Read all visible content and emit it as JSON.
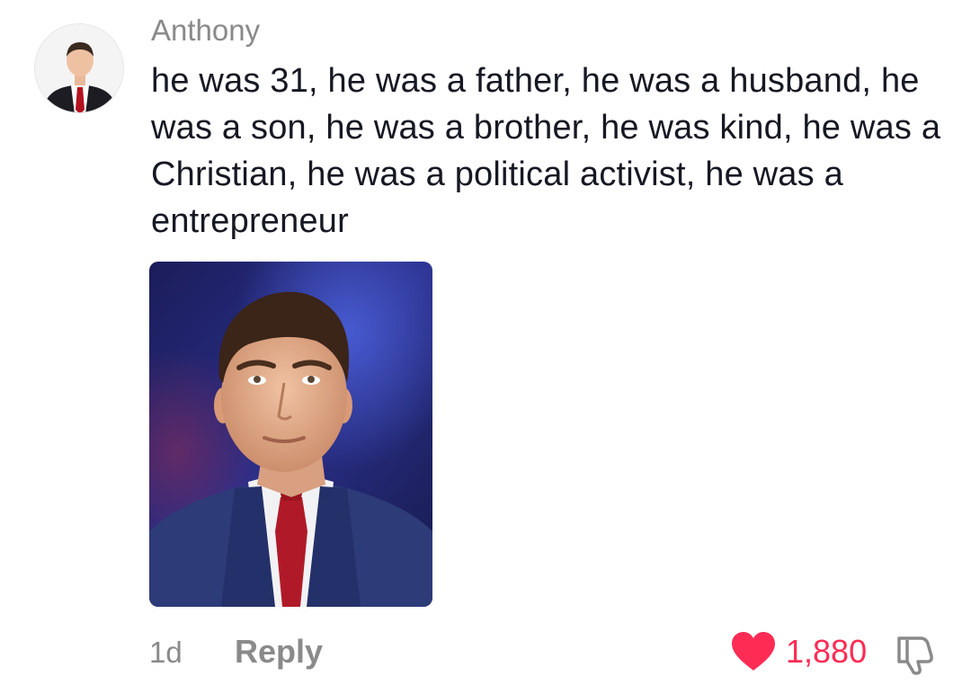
{
  "comment": {
    "username": "Anthony",
    "text": "he was 31, he was a father, he was a husband, he was a son, he was a brother, he was kind, he was a Christian, he was a political activist, he was a entrepreneur",
    "timestamp": "1d",
    "reply_label": "Reply",
    "like_count": "1,880",
    "like_color": "#fe2c55",
    "icons": {
      "like": "heart-icon",
      "dislike": "thumbs-down-icon"
    }
  }
}
